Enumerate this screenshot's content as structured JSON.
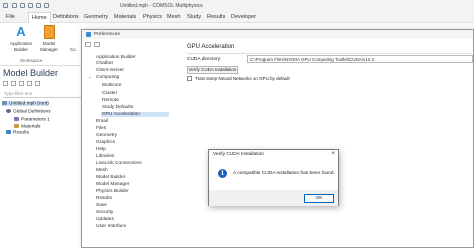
{
  "window": {
    "title": "Untitled.mph - COMSOL Multiphysics"
  },
  "menu": {
    "tabs": [
      "File",
      "Home",
      "Definitions",
      "Geometry",
      "Materials",
      "Physics",
      "Mesh",
      "Study",
      "Results",
      "Developer"
    ]
  },
  "ribbon": {
    "app_builder": "Application\nBuilder",
    "model_manager": "Model\nManager",
    "group": "Workspace",
    "cut_off": "Co"
  },
  "model_builder": {
    "title": "Model Builder",
    "filter_placeholder": "Type filter text",
    "tree": [
      "Untitled.mph (root)",
      "Global Definitions",
      "Parameters 1",
      "Materials",
      "Results"
    ]
  },
  "preferences": {
    "title": "Preferences",
    "items": [
      "Application Builder",
      "Chatbot",
      "Client-Server",
      "Computing",
      "Multicore",
      "Cluster",
      "Remote",
      "Study Defaults",
      "GPU Acceleration",
      "Email",
      "Files",
      "Geometry",
      "Graphics",
      "Help",
      "Libraries",
      "LiveLink Connections",
      "Mesh",
      "Model Builder",
      "Model Manager",
      "Physics Builder",
      "Results",
      "Save",
      "Security",
      "Updates",
      "User Interface"
    ],
    "gpu": {
      "heading": "GPU Acceleration",
      "cuda_label": "CUDA directory:",
      "cuda_path": "C:\\Program Files\\NVIDIA GPU Computing Toolkit\\CUDA\\v12.4",
      "verify_button": "Verify CUDA Installation",
      "train_label": "Train Deep Neural Networks on GPU by default"
    }
  },
  "verify_dialog": {
    "title": "Verify CUDA Installation",
    "message": "A compatible CUDA installation has been found.",
    "ok": "OK"
  }
}
